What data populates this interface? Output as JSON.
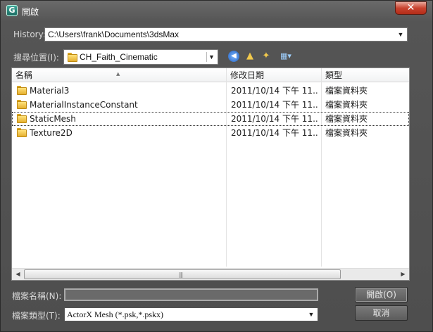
{
  "window": {
    "title": "開啟",
    "app_icon_glyph": "G",
    "close_glyph": "✕"
  },
  "history": {
    "label": "History:",
    "value": "C:\\Users\\frank\\Documents\\3dsMax"
  },
  "look_in": {
    "label": "搜尋位置(I):",
    "value": "CH_Faith_Cinematic"
  },
  "toolbar_icons": [
    "back-icon",
    "up-folder-icon",
    "new-folder-icon",
    "view-menu-icon"
  ],
  "columns": {
    "name": "名稱",
    "modified": "修改日期",
    "type": "類型"
  },
  "files": [
    {
      "name": "Material3",
      "modified": "2011/10/14 下午 11...",
      "type": "檔案資料夾"
    },
    {
      "name": "MaterialInstanceConstant",
      "modified": "2011/10/14 下午 11...",
      "type": "檔案資料夾"
    },
    {
      "name": "StaticMesh",
      "modified": "2011/10/14 下午 11...",
      "type": "檔案資料夾"
    },
    {
      "name": "Texture2D",
      "modified": "2011/10/14 下午 11...",
      "type": "檔案資料夾"
    }
  ],
  "filename": {
    "label": "檔案名稱(N):",
    "value": ""
  },
  "filetype": {
    "label": "檔案類型(T):",
    "value": "ActorX Mesh (*.psk,*.pskx)"
  },
  "buttons": {
    "open": "開啟(O)",
    "cancel": "取消"
  },
  "colors": {
    "dialog_background": "#4e4e4e",
    "close_button": "#c9432f",
    "folder_icon": "#e5b030"
  }
}
